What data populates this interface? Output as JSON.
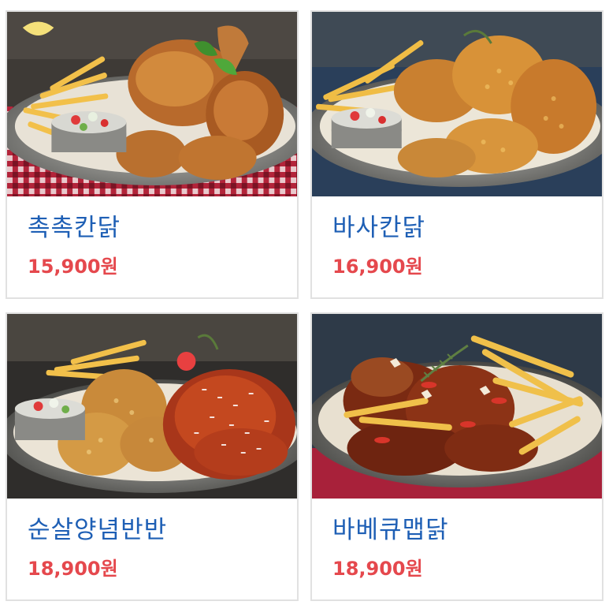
{
  "menu": {
    "items": [
      {
        "name": "촉촉칸닭",
        "price": "15,900원",
        "image": "roast-chicken-with-fries-photo"
      },
      {
        "name": "바사칸닭",
        "price": "16,900원",
        "image": "crispy-fried-chicken-with-fries-photo"
      },
      {
        "name": "순살양념반반",
        "price": "18,900원",
        "image": "half-crispy-half-sauced-boneless-chicken-photo"
      },
      {
        "name": "바베큐맵닭",
        "price": "18,900원",
        "image": "spicy-bbq-chicken-with-fries-photo"
      }
    ]
  },
  "colors": {
    "name": "#1e5fb5",
    "price": "#e5484d",
    "card_border": "#e1e1e1"
  }
}
